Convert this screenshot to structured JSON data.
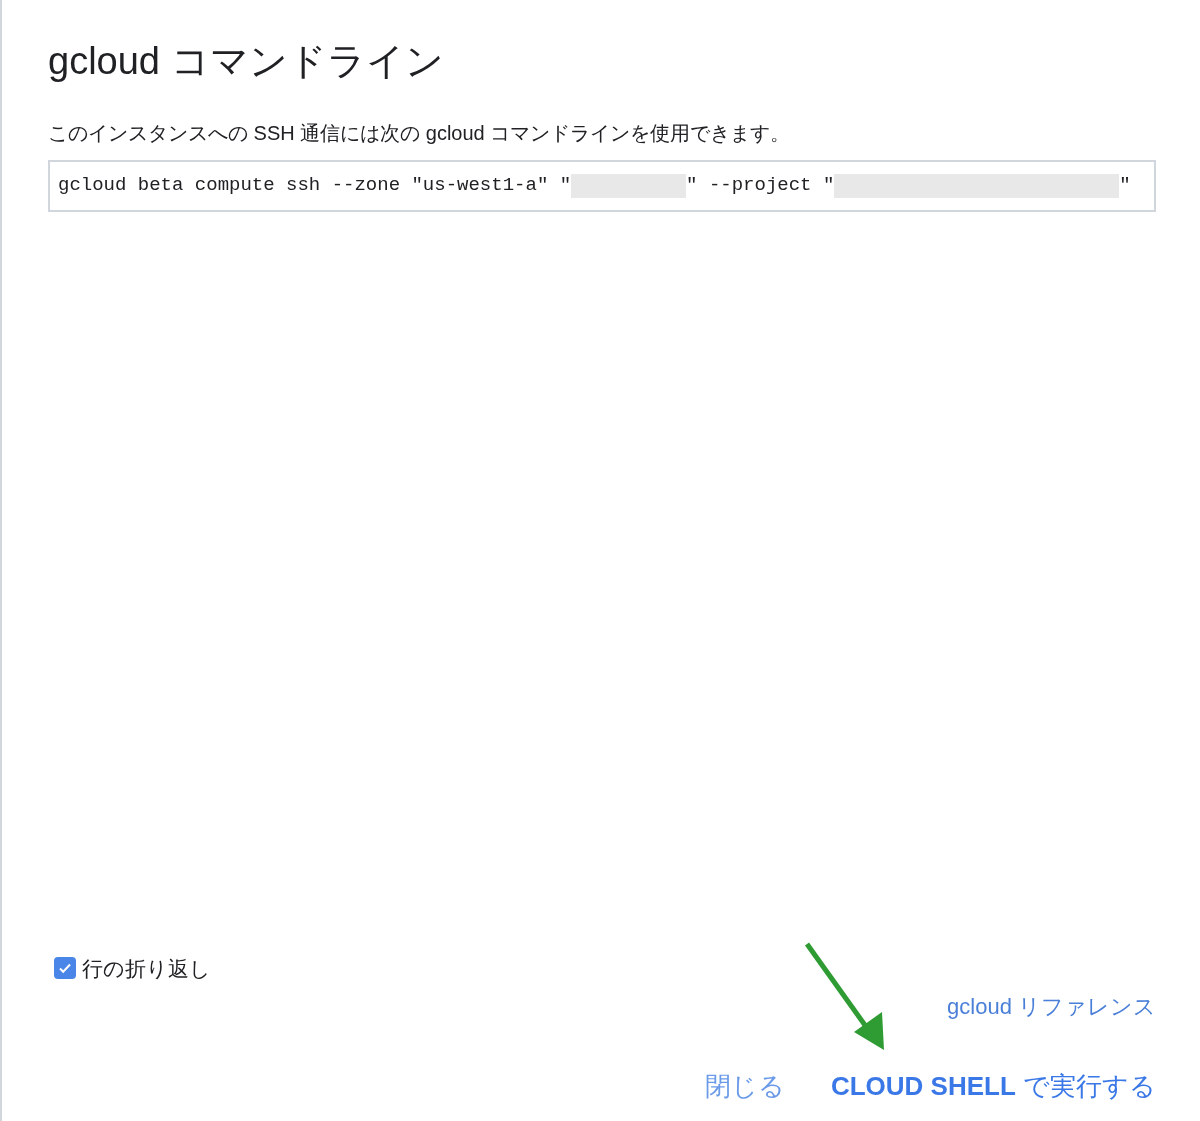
{
  "dialog": {
    "title": "gcloud コマンドライン",
    "description": "このインスタンスへの SSH 通信には次の gcloud コマンドラインを使用できます。",
    "command": [
      {
        "kind": "text",
        "text": "gcloud beta compute ssh --zone \"us-west1-a\" \""
      },
      {
        "kind": "redacted"
      },
      {
        "kind": "text",
        "text": "\" --project \""
      },
      {
        "kind": "redacted"
      },
      {
        "kind": "text",
        "text": "\""
      }
    ],
    "wrap_lines": {
      "label": "行の折り返し",
      "checked": true
    },
    "reference_link": "gcloud リファレンス",
    "buttons": [
      {
        "kind": "plain",
        "label": "閉じる"
      },
      {
        "kind": "primary",
        "label": "**CLOUD SHELL** で実行する"
      }
    ]
  }
}
